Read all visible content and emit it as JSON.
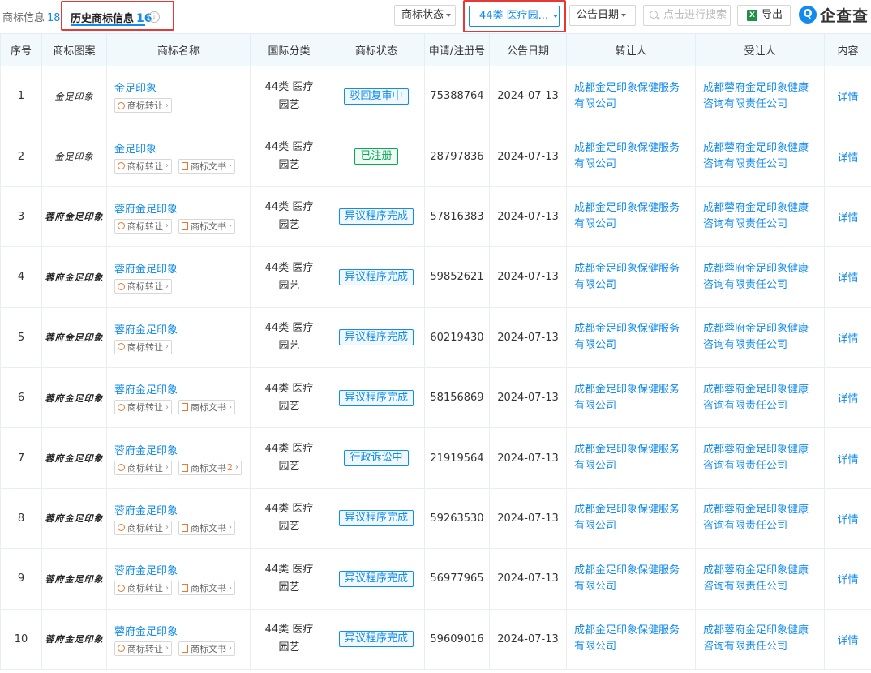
{
  "tabs": {
    "trademark_info": {
      "label": "商标信息",
      "count": "18"
    },
    "history_info": {
      "label": "历史商标信息",
      "count": "16",
      "info_icon": "info-icon"
    }
  },
  "filters": {
    "status_label": "商标状态",
    "class_label": "44类 医疗园...",
    "date_label": "公告日期",
    "search_placeholder": "点击进行搜索",
    "export_label": "导出",
    "export_icon": "excel-icon"
  },
  "brand": {
    "logo_text": "企查查",
    "logo_icon": "qichacha-logo-icon"
  },
  "colors": {
    "accent": "#128bed",
    "highlight_border": "#e53935",
    "status_green": "#07a85a",
    "chip_icon": "#e8772e"
  },
  "table": {
    "headers": [
      "序号",
      "商标图案",
      "商标名称",
      "国际分类",
      "商标状态",
      "申请/注册号",
      "公告日期",
      "转让人",
      "受让人",
      "内容"
    ],
    "rows": [
      {
        "no": "1",
        "logo": "金足印象",
        "name": "金足印象",
        "chips": [
          {
            "label": "商标转让",
            "type": "transfer"
          }
        ],
        "cls": "44类 医疗园艺",
        "status": "驳回复审中",
        "status_color": "blue",
        "regno": "75388764",
        "date": "2024-07-13",
        "transferor": "成都金足印象保健服务有限公司",
        "transferee": "成都蓉府金足印象健康咨询有限责任公司",
        "detail": "详情"
      },
      {
        "no": "2",
        "logo": "金足印象",
        "name": "金足印象",
        "chips": [
          {
            "label": "商标转让",
            "type": "transfer"
          },
          {
            "label": "商标文书",
            "type": "doc"
          }
        ],
        "cls": "44类 医疗园艺",
        "status": "已注册",
        "status_color": "green",
        "regno": "28797836",
        "date": "2024-07-13",
        "transferor": "成都金足印象保健服务有限公司",
        "transferee": "成都蓉府金足印象健康咨询有限责任公司",
        "detail": "详情"
      },
      {
        "no": "3",
        "logo": "蓉府金足印象",
        "name": "蓉府金足印象",
        "chips": [
          {
            "label": "商标转让",
            "type": "transfer"
          },
          {
            "label": "商标文书",
            "type": "doc"
          }
        ],
        "cls": "44类 医疗园艺",
        "status": "异议程序完成",
        "status_color": "blue",
        "regno": "57816383",
        "date": "2024-07-13",
        "transferor": "成都金足印象保健服务有限公司",
        "transferee": "成都蓉府金足印象健康咨询有限责任公司",
        "detail": "详情"
      },
      {
        "no": "4",
        "logo": "蓉府金足印象",
        "name": "蓉府金足印象",
        "chips": [
          {
            "label": "商标转让",
            "type": "transfer"
          }
        ],
        "cls": "44类 医疗园艺",
        "status": "异议程序完成",
        "status_color": "blue",
        "regno": "59852621",
        "date": "2024-07-13",
        "transferor": "成都金足印象保健服务有限公司",
        "transferee": "成都蓉府金足印象健康咨询有限责任公司",
        "detail": "详情"
      },
      {
        "no": "5",
        "logo": "蓉府金足印象",
        "name": "蓉府金足印象",
        "chips": [
          {
            "label": "商标转让",
            "type": "transfer"
          }
        ],
        "cls": "44类 医疗园艺",
        "status": "异议程序完成",
        "status_color": "blue",
        "regno": "60219430",
        "date": "2024-07-13",
        "transferor": "成都金足印象保健服务有限公司",
        "transferee": "成都蓉府金足印象健康咨询有限责任公司",
        "detail": "详情"
      },
      {
        "no": "6",
        "logo": "蓉府金足印象",
        "name": "蓉府金足印象",
        "chips": [
          {
            "label": "商标转让",
            "type": "transfer"
          },
          {
            "label": "商标文书",
            "type": "doc"
          }
        ],
        "cls": "44类 医疗园艺",
        "status": "异议程序完成",
        "status_color": "blue",
        "regno": "58156869",
        "date": "2024-07-13",
        "transferor": "成都金足印象保健服务有限公司",
        "transferee": "成都蓉府金足印象健康咨询有限责任公司",
        "detail": "详情"
      },
      {
        "no": "7",
        "logo": "蓉府金足印象",
        "name": "蓉府金足印象",
        "chips": [
          {
            "label": "商标转让",
            "type": "transfer"
          },
          {
            "label": "商标文书",
            "type": "doc",
            "count": "2"
          }
        ],
        "cls": "44类 医疗园艺",
        "status": "行政诉讼中",
        "status_color": "blue",
        "regno": "21919564",
        "date": "2024-07-13",
        "transferor": "成都金足印象保健服务有限公司",
        "transferee": "成都蓉府金足印象健康咨询有限责任公司",
        "detail": "详情"
      },
      {
        "no": "8",
        "logo": "蓉府金足印象",
        "name": "蓉府金足印象",
        "chips": [
          {
            "label": "商标转让",
            "type": "transfer"
          },
          {
            "label": "商标文书",
            "type": "doc"
          }
        ],
        "cls": "44类 医疗园艺",
        "status": "异议程序完成",
        "status_color": "blue",
        "regno": "59263530",
        "date": "2024-07-13",
        "transferor": "成都金足印象保健服务有限公司",
        "transferee": "成都蓉府金足印象健康咨询有限责任公司",
        "detail": "详情"
      },
      {
        "no": "9",
        "logo": "蓉府金足印象",
        "name": "蓉府金足印象",
        "chips": [
          {
            "label": "商标转让",
            "type": "transfer"
          },
          {
            "label": "商标文书",
            "type": "doc"
          }
        ],
        "cls": "44类 医疗园艺",
        "status": "异议程序完成",
        "status_color": "blue",
        "regno": "56977965",
        "date": "2024-07-13",
        "transferor": "成都金足印象保健服务有限公司",
        "transferee": "成都蓉府金足印象健康咨询有限责任公司",
        "detail": "详情"
      },
      {
        "no": "10",
        "logo": "蓉府金足印象",
        "name": "蓉府金足印象",
        "chips": [
          {
            "label": "商标转让",
            "type": "transfer"
          },
          {
            "label": "商标文书",
            "type": "doc"
          }
        ],
        "cls": "44类 医疗园艺",
        "status": "异议程序完成",
        "status_color": "blue",
        "regno": "59609016",
        "date": "2024-07-13",
        "transferor": "成都金足印象保健服务有限公司",
        "transferee": "成都蓉府金足印象健康咨询有限责任公司",
        "detail": "详情"
      }
    ]
  }
}
